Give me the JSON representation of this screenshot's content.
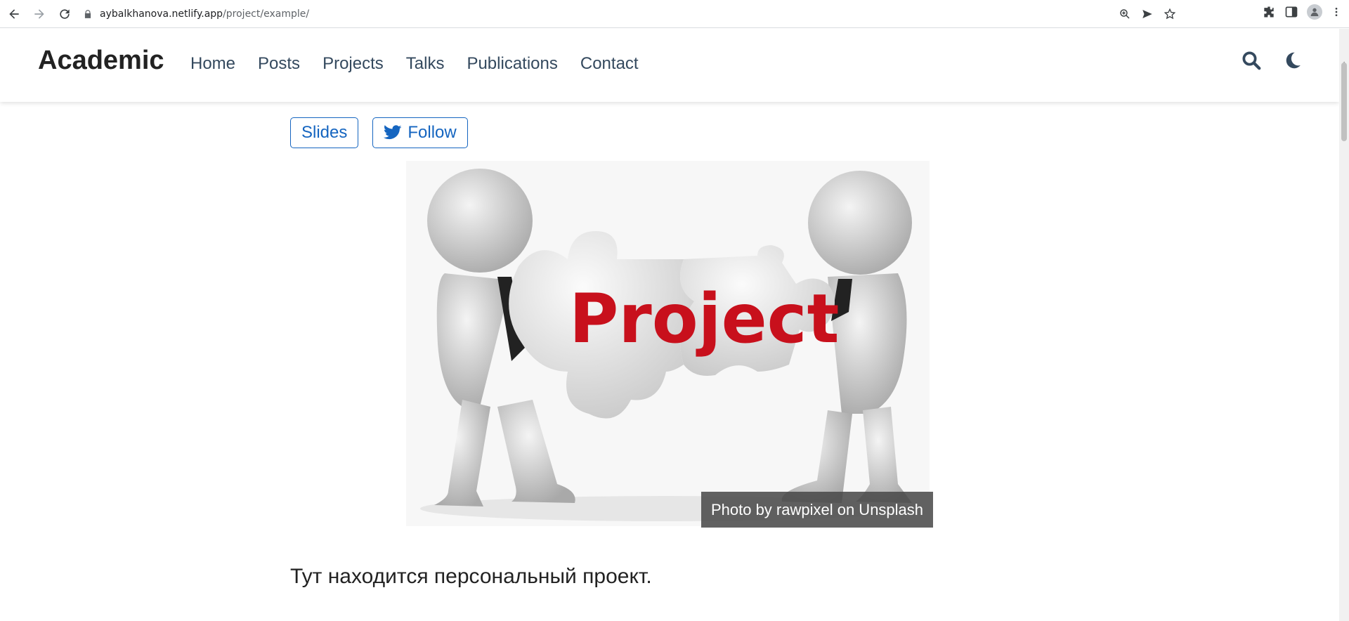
{
  "browser": {
    "url_host": "aybalkhanova.netlify.app",
    "url_path": "/project/example/"
  },
  "site": {
    "brand": "Academic",
    "nav": [
      "Home",
      "Posts",
      "Projects",
      "Talks",
      "Publications",
      "Contact"
    ]
  },
  "buttons": {
    "slides": "Slides",
    "follow": "Follow"
  },
  "figure": {
    "image_text": "Project",
    "caption": "Photo by rawpixel on Unsplash"
  },
  "content": {
    "lead": "Тут находится персональный проект."
  },
  "colors": {
    "accent": "#1565c0",
    "nav_text": "#34495e",
    "image_red": "#c8101c"
  }
}
